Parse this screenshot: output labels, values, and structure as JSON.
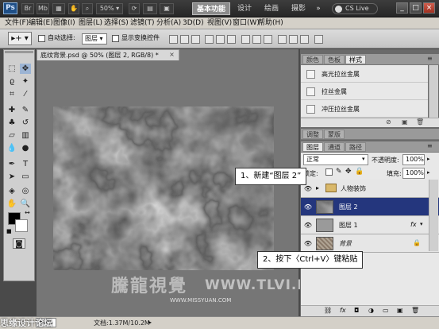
{
  "titlebar": {
    "logo": "Ps",
    "zoom": "50%",
    "workspaces": [
      "基本功能",
      "设计",
      "绘画",
      "摄影"
    ],
    "more": "»",
    "cs_live": "CS Live",
    "minimize": "_",
    "maximize": "□",
    "close": "×"
  },
  "menubar": {
    "items": [
      "文件(F)",
      "编辑(E)",
      "图像(I)",
      "图层(L)",
      "选择(S)",
      "滤镜(T)",
      "分析(A)",
      "3D(D)",
      "视图(V)",
      "窗口(W)",
      "帮助(H)"
    ]
  },
  "options": {
    "auto_select_label": "自动选择:",
    "auto_select_value": "图层",
    "show_transform_label": "显示变换控件"
  },
  "document": {
    "tab_title": "底纹背景.psd @ 50% (图层 2, RGB/8) *",
    "tab_close": "×"
  },
  "watermark": {
    "chinese": "騰龍視覺",
    "url": "WWW.TLVI.NET",
    "site": "WWW.MISSYUAN.COM"
  },
  "statusbar": {
    "zoom": "50%",
    "doc_info": "文档:1.37M/10.2M",
    "corner_watermark": "思缘设计论坛"
  },
  "styles_panel": {
    "tabs": [
      "颜色",
      "色板",
      "样式"
    ],
    "active_tab": "样式",
    "items": [
      "高光拉丝金属",
      "拉丝金属",
      "冲压拉丝金属"
    ]
  },
  "adjust_panel": {
    "tabs": [
      "调整",
      "蒙版"
    ]
  },
  "layers_panel": {
    "tabs": [
      "图层",
      "通道",
      "路径"
    ],
    "blend_mode": "正常",
    "opacity_label": "不透明度:",
    "opacity": "100%",
    "lock_label": "锁定:",
    "fill_label": "填充:",
    "fill": "100%",
    "layers": [
      {
        "name": "人物装饰",
        "type": "group",
        "selected": false
      },
      {
        "name": "图层 2",
        "type": "layer",
        "selected": true
      },
      {
        "name": "图层 1",
        "type": "layer",
        "selected": false,
        "fx": "fx"
      },
      {
        "name": "背景",
        "type": "background",
        "selected": false
      }
    ]
  },
  "callouts": {
    "step1": "1、新建“图层 2”",
    "step2": "2、按下〈Ctrl+V〉键粘贴"
  },
  "colors": {
    "selected_layer": "#24367d",
    "ws_active": "#8b8b8b",
    "panel_bg": "#e8e8e8"
  }
}
